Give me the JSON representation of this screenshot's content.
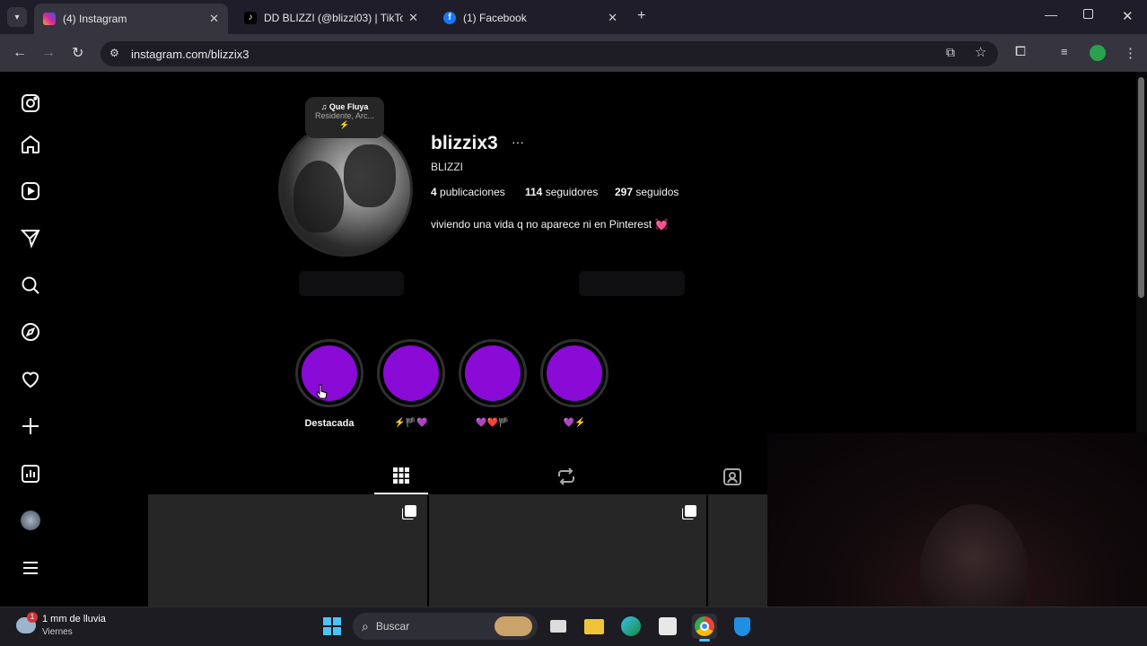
{
  "browser": {
    "tabs": [
      {
        "label": "(4) Instagram",
        "icon": "instagram-icon",
        "active": true
      },
      {
        "label": "DD BLIZZI (@blizzi03) | TikTok",
        "icon": "tiktok-icon",
        "active": false
      },
      {
        "label": "(1) Facebook",
        "icon": "facebook-icon",
        "active": false
      }
    ],
    "url": "instagram.com/blizzix3"
  },
  "sidebar": {
    "items": [
      "instagram-logo-icon",
      "home-icon",
      "reels-icon",
      "send-icon",
      "search-icon",
      "explore-icon",
      "heart-icon",
      "create-icon",
      "dashboard-icon",
      "profile-avatar",
      "menu-icon"
    ]
  },
  "profile": {
    "username": "blizzix3",
    "more": "···",
    "full_name": "BLIZZI",
    "posts": "4",
    "posts_label": "publicaciones",
    "followers": "114",
    "followers_label": "seguidores",
    "following": "297",
    "following_label": "seguidos",
    "bio": "viviendo una vida q no aparece ni en Pinterest",
    "bio_emoji": "💓",
    "note_title": "Que Fluya",
    "note_sub": "Residente, Arc...",
    "note_emoji": "⚡"
  },
  "highlights": [
    {
      "label": "Destacada"
    },
    {
      "label": "⚡🏴💜"
    },
    {
      "label": "💜❤️🏴"
    },
    {
      "label": "💜⚡"
    }
  ],
  "taskbar": {
    "weather_title": "1 mm de lluvia",
    "weather_sub": "Viernes",
    "weather_badge": "1",
    "search_placeholder": "Buscar"
  },
  "colors": {
    "highlight": "#8a0ad6",
    "accent_blue": "#0095f6"
  }
}
